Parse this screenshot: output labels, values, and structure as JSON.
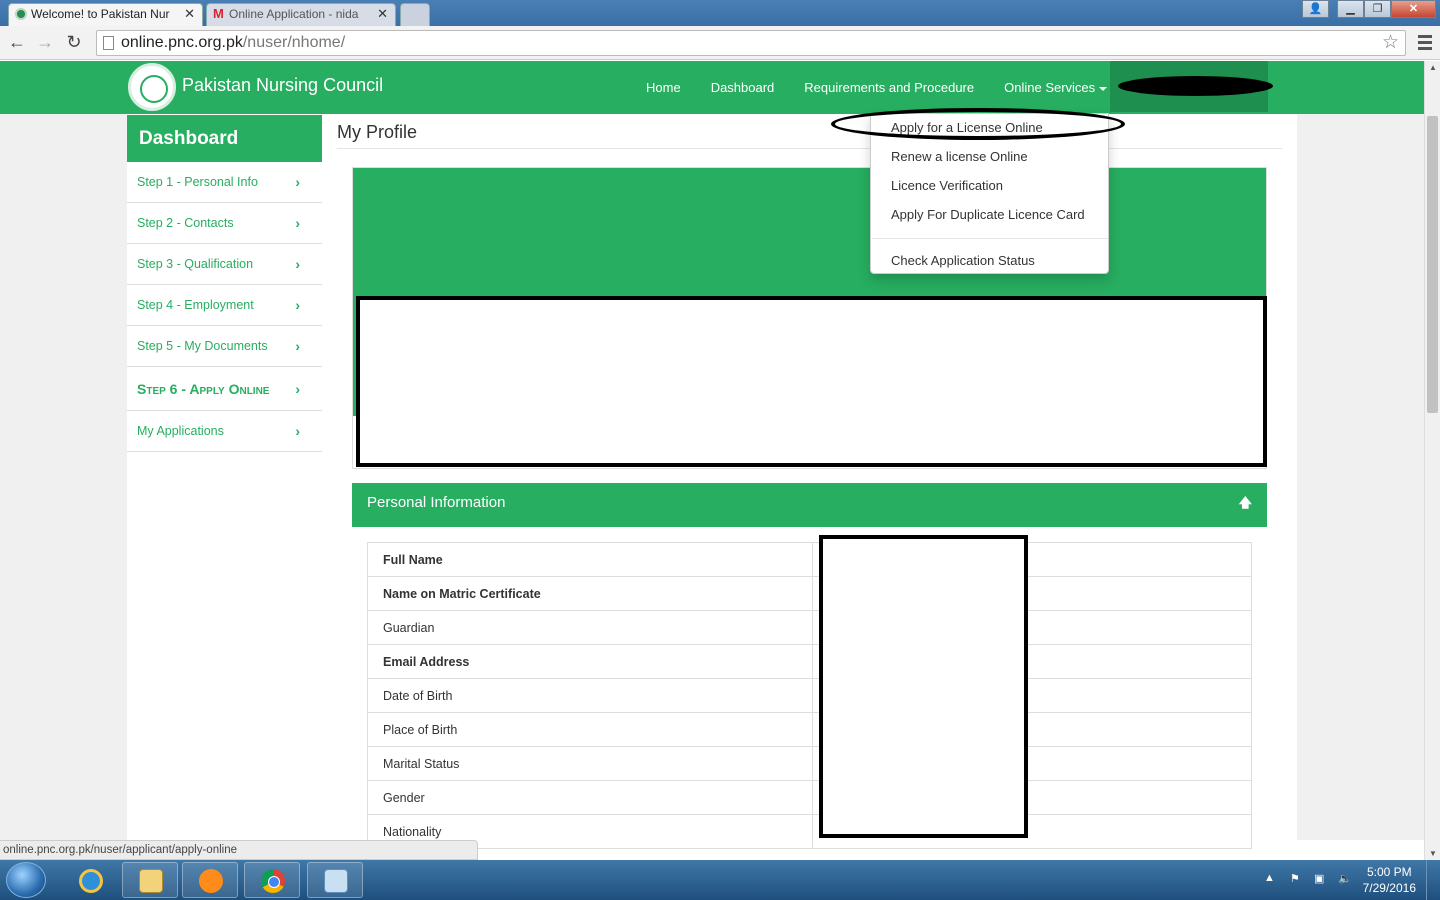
{
  "browser": {
    "tabs": [
      {
        "title": "Welcome! to Pakistan Nur",
        "active": true
      },
      {
        "title": "Online Application - nida",
        "active": false
      }
    ],
    "url_host": "online.pnc.org.pk",
    "url_path": "/nuser/nhome/",
    "status_url": "online.pnc.org.pk/nuser/applicant/apply-online"
  },
  "site": {
    "brand": "Pakistan Nursing Council",
    "nav": [
      {
        "label": "Home"
      },
      {
        "label": "Dashboard"
      },
      {
        "label": "Requirements and Procedure"
      },
      {
        "label": "Online Services",
        "dropdown": true
      }
    ],
    "colors": {
      "primary": "#27ae60",
      "user_area": "#1e8f4e"
    }
  },
  "dropdown": {
    "items": [
      "Apply for a License Online",
      "Renew a license Online",
      "Licence Verification",
      "Apply For Duplicate Licence Card",
      "Check Application Status"
    ]
  },
  "sidebar": {
    "title": "Dashboard",
    "items": [
      {
        "label": "Step 1 - Personal Info"
      },
      {
        "label": "Step 2 - Contacts"
      },
      {
        "label": "Step 3 - Qualification"
      },
      {
        "label": "Step 4 - Employment"
      },
      {
        "label": "Step 5 - My Documents"
      },
      {
        "label": "Step 6 - Apply Online",
        "active": true
      },
      {
        "label": "My Applications"
      }
    ]
  },
  "main": {
    "page_title": "My Profile",
    "section_title": "Personal Information",
    "fields": [
      {
        "label": "Full Name",
        "bold": true
      },
      {
        "label": "Name on Matric Certificate",
        "bold": true
      },
      {
        "label": "Guardian",
        "bold": false
      },
      {
        "label": "Email Address",
        "bold": true
      },
      {
        "label": "Date of Birth",
        "bold": false
      },
      {
        "label": "Place of Birth",
        "bold": false
      },
      {
        "label": "Marital Status",
        "bold": false
      },
      {
        "label": "Gender",
        "bold": false
      },
      {
        "label": "Nationality",
        "bold": false
      }
    ]
  },
  "taskbar": {
    "clock_time": "5:00 PM",
    "clock_date": "7/29/2016"
  }
}
